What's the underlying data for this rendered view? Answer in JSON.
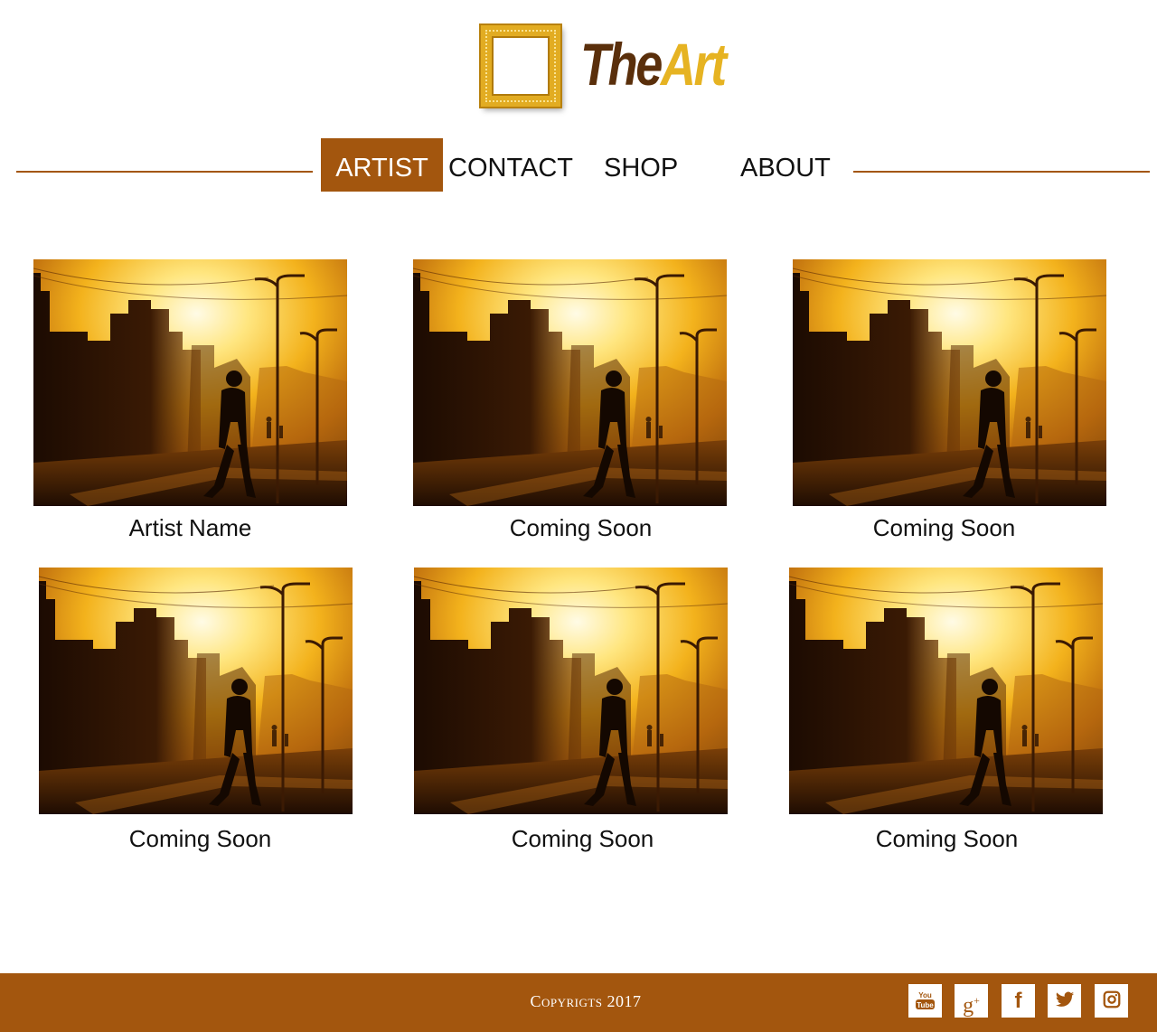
{
  "brand": {
    "name_part1": "The",
    "name_part2": "Art"
  },
  "nav": {
    "items": [
      {
        "label": "ARTIST",
        "active": true
      },
      {
        "label": "CONTACT",
        "active": false
      },
      {
        "label": "SHOP",
        "active": false
      },
      {
        "label": "ABOUT",
        "active": false
      }
    ]
  },
  "gallery": {
    "cards": [
      {
        "caption": "Artist Name"
      },
      {
        "caption": "Coming Soon"
      },
      {
        "caption": "Coming Soon"
      },
      {
        "caption": "Coming Soon"
      },
      {
        "caption": "Coming Soon"
      },
      {
        "caption": "Coming Soon"
      }
    ]
  },
  "footer": {
    "copyright": "Copyrigts 2017",
    "social": [
      {
        "icon": "youtube-icon",
        "label": "You Tube"
      },
      {
        "icon": "google-plus-icon",
        "label": "g+"
      },
      {
        "icon": "facebook-icon",
        "label": "f"
      },
      {
        "icon": "twitter-icon",
        "label": ""
      },
      {
        "icon": "instagram-icon",
        "label": ""
      }
    ]
  },
  "colors": {
    "accent": "#a3560e",
    "gold": "#e6b322",
    "dark_brown": "#5a2f0b"
  }
}
